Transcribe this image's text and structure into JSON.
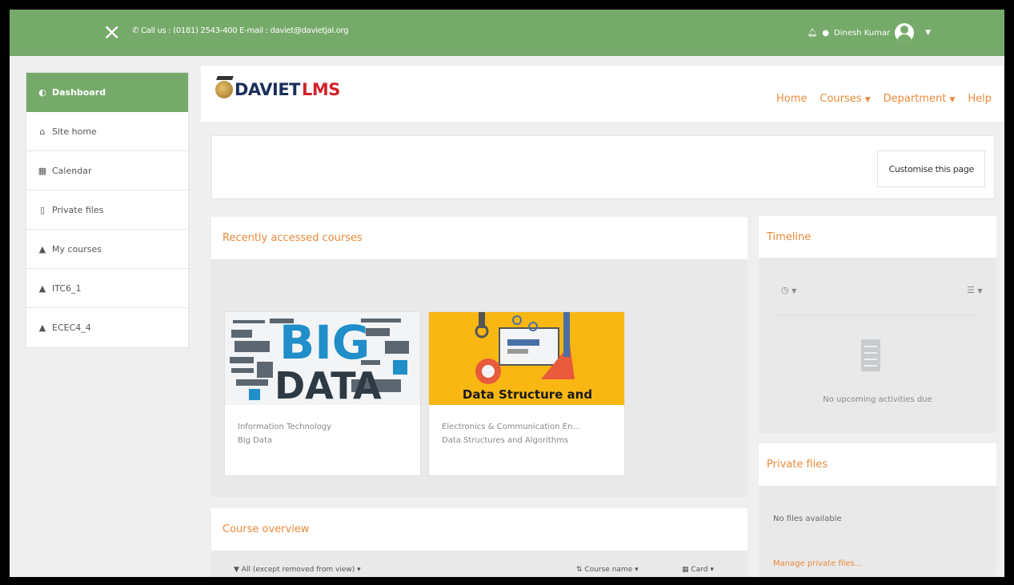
{
  "topbar": {
    "close_icon": "×",
    "contact": "Call us : (0181) 2543-400 E-mail : daviet@davietjal.org",
    "user_name": "Dinesh Kumar"
  },
  "sidebar": {
    "items": [
      {
        "icon": "dashboard-icon",
        "glyph": "◐",
        "label": "Dashboard"
      },
      {
        "icon": "home-icon",
        "glyph": "⌂",
        "label": "Site home"
      },
      {
        "icon": "calendar-icon",
        "glyph": "▦",
        "label": "Calendar"
      },
      {
        "icon": "file-icon",
        "glyph": "▯",
        "label": "Private files"
      },
      {
        "icon": "graduation-cap-icon",
        "glyph": "▲",
        "label": "My courses"
      },
      {
        "icon": "graduation-cap-icon",
        "glyph": "▲",
        "label": "ITC6_1"
      },
      {
        "icon": "graduation-cap-icon",
        "glyph": "▲",
        "label": "ECEC4_4"
      }
    ]
  },
  "header": {
    "logo_part1": "DAVIET",
    "logo_part2": "LMS",
    "nav": {
      "home": "Home",
      "courses": "Courses",
      "department": "Department",
      "help": "Help"
    }
  },
  "customise": {
    "button": "Customise this page"
  },
  "recent": {
    "title": "Recently accessed courses",
    "courses": [
      {
        "category": "Information Technology",
        "name": "Big Data",
        "image_text": "BIG DATA"
      },
      {
        "category": "Electronics & Communication En...",
        "name": "Data Structures and Algorithms",
        "image_text": "Data Structure and"
      }
    ]
  },
  "overview": {
    "title": "Course overview",
    "filter": "All (except removed from view)",
    "sort": "Course name",
    "view": "Card"
  },
  "timeline": {
    "title": "Timeline",
    "empty": "No upcoming activities due"
  },
  "private_files": {
    "title": "Private files",
    "none": "No files available",
    "manage": "Manage private files..."
  },
  "colors": {
    "accent": "#76aa6a",
    "link": "#e88a3a"
  }
}
